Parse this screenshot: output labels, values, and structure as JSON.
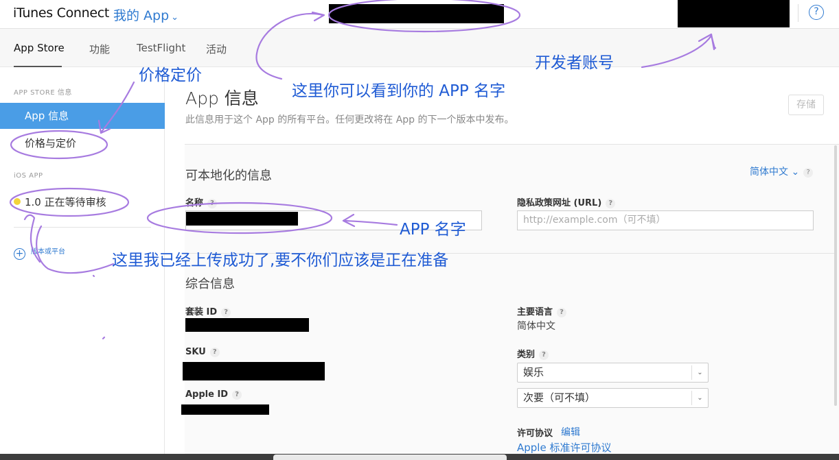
{
  "header": {
    "brand": "iTunes Connect",
    "my_app": "我的 App",
    "help": "?"
  },
  "tabs": [
    {
      "label": "App Store"
    },
    {
      "label": "功能"
    },
    {
      "label": "TestFlight"
    },
    {
      "label": "活动"
    }
  ],
  "sidebar": {
    "section_appstore": "APP STORE 信息",
    "app_info": "App 信息",
    "pricing": "价格与定价",
    "section_ios": "iOS APP",
    "build": "1.0 正在等待审核",
    "add_platform": "版本或平台"
  },
  "main": {
    "title": "App 信息",
    "subtitle": "此信息用于这个 App 的所有平台。任何更改将在 App 的下一个版本中发布。",
    "save": "存储",
    "localizable_title": "可本地化的信息",
    "language": "简体中文",
    "name_label": "名称",
    "privacy_label": "隐私政策网址 (URL)",
    "privacy_placeholder": "http://example.com（可不填）",
    "general_title": "综合信息",
    "bundle_label": "套装 ID",
    "sku_label": "SKU",
    "appleid_label": "Apple ID",
    "primary_lang_label": "主要语言",
    "primary_lang_value": "简体中文",
    "category_label": "类别",
    "category_primary": "娱乐",
    "category_secondary": "次要（可不填）",
    "license_label": "许可协议",
    "license_edit": "编辑",
    "license_value": "Apple 标准许可协议"
  },
  "annotations": {
    "pricing": "价格定价",
    "app_name_here": "这里你可以看到你的 APP 名字",
    "developer_account": "开发者账号",
    "app_name": "APP 名字",
    "uploaded": "这里我已经上传成功了,要不你们应该是正在准备"
  },
  "colors": {
    "accent": "#2f7ad0",
    "sidebar_active": "#4a9de6",
    "annotation_ink": "#a77be0",
    "annotation_text": "#1f5bd4"
  }
}
